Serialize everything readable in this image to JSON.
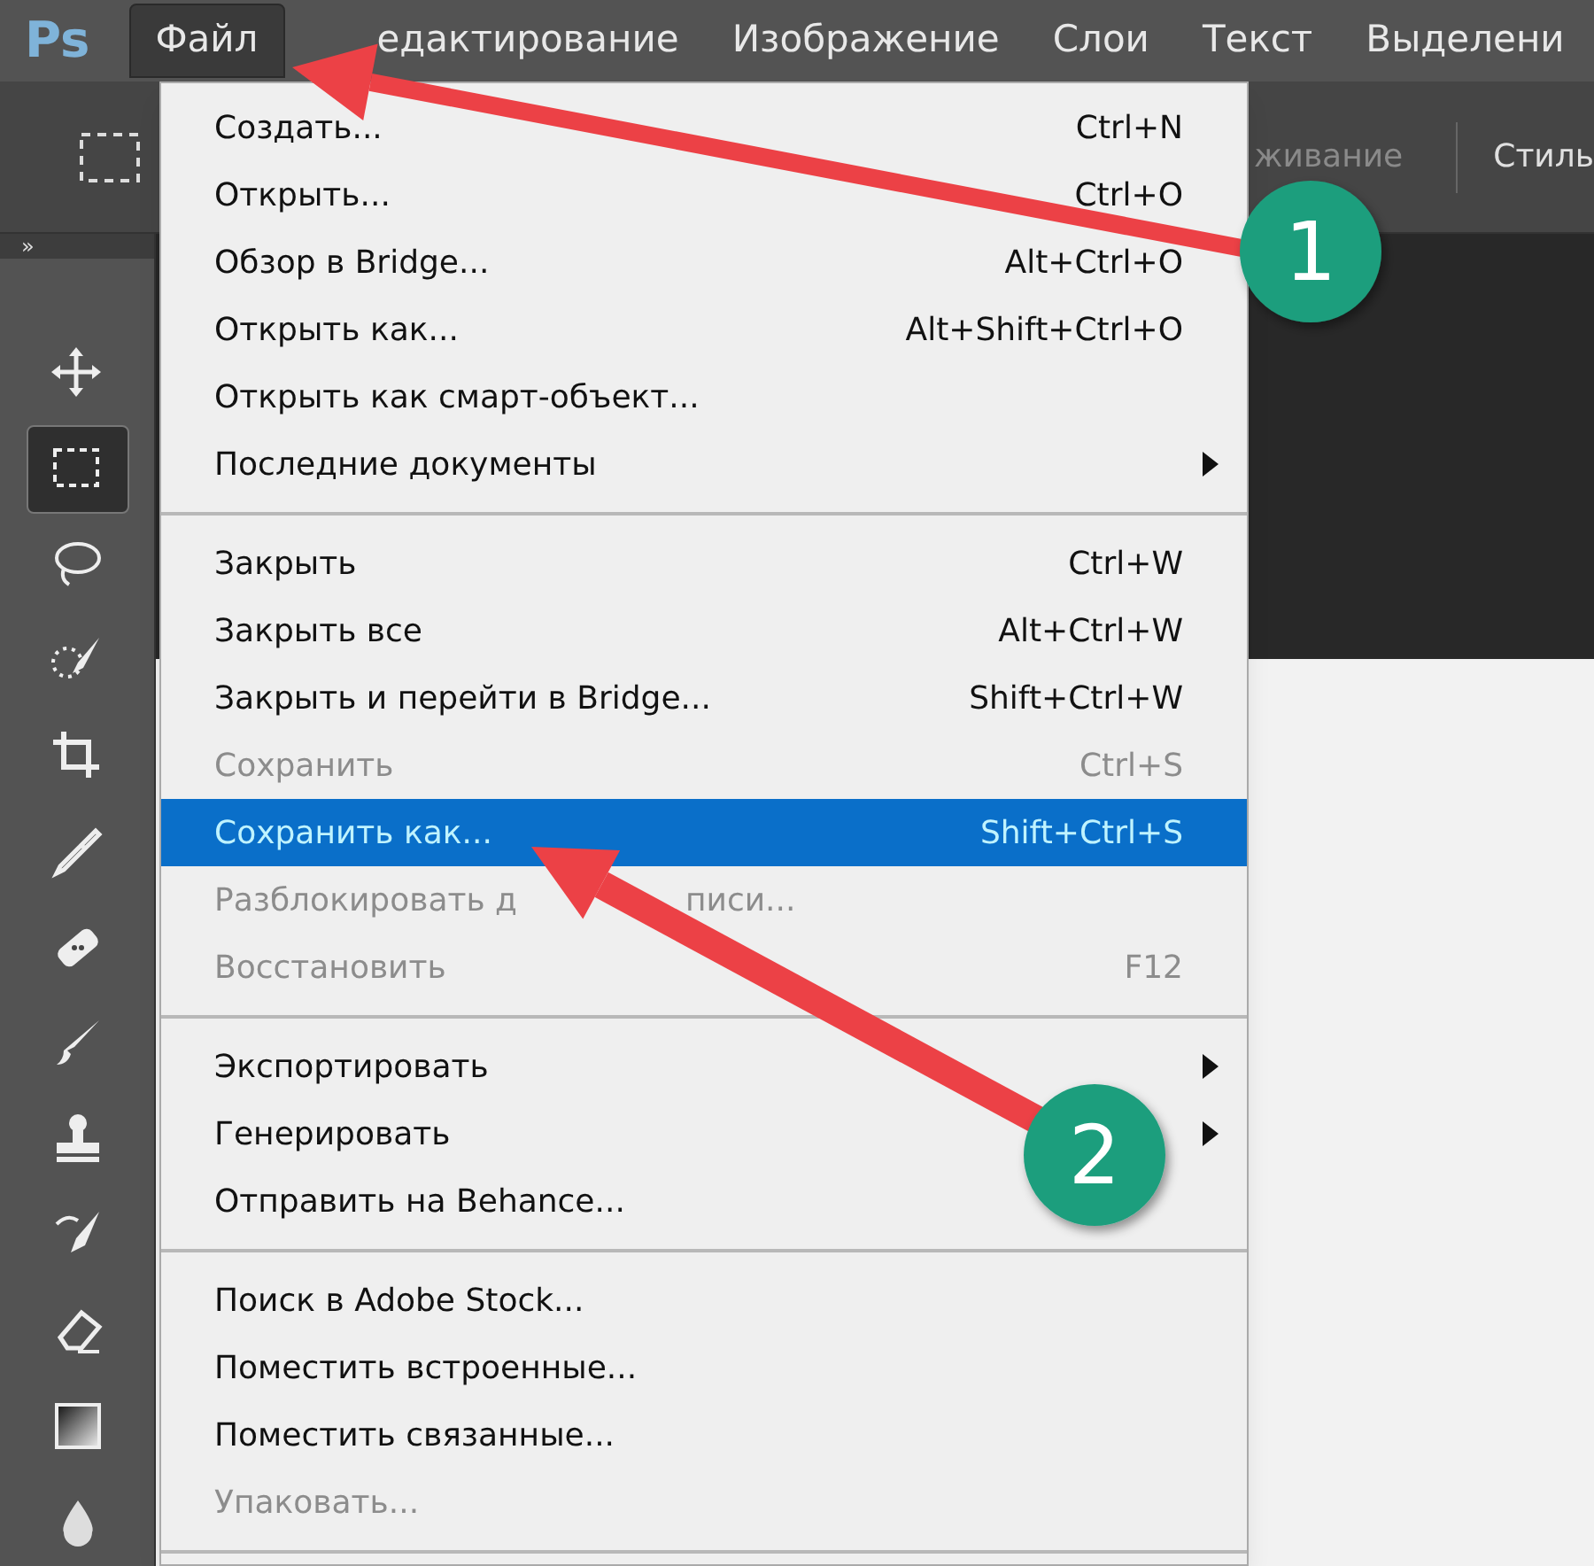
{
  "app_logo": "Ps",
  "menubar": [
    {
      "label": "Файл",
      "selected": true
    },
    {
      "label": "едактирование",
      "selected": false
    },
    {
      "label": "Изображение",
      "selected": false
    },
    {
      "label": "Слои",
      "selected": false
    },
    {
      "label": "Текст",
      "selected": false
    },
    {
      "label": "Выделени",
      "selected": false
    }
  ],
  "options_bar": {
    "dimmed_label": "живание",
    "style_label": "Стиль"
  },
  "panel_collapse": "»",
  "tools": [
    {
      "selected": false
    },
    {
      "selected": true
    },
    {
      "selected": false
    },
    {
      "selected": false
    },
    {
      "selected": false
    },
    {
      "selected": false
    },
    {
      "selected": false
    },
    {
      "selected": false
    },
    {
      "selected": false
    },
    {
      "selected": false
    },
    {
      "selected": false
    },
    {
      "selected": false
    },
    {
      "selected": false
    }
  ],
  "file_menu": [
    {
      "kind": "item",
      "label": "Создать...",
      "shortcut": "Ctrl+N",
      "disabled": false,
      "selected": false,
      "submenu": false
    },
    {
      "kind": "item",
      "label": "Открыть...",
      "shortcut": "Ctrl+O",
      "disabled": false,
      "selected": false,
      "submenu": false
    },
    {
      "kind": "item",
      "label": "Обзор в Bridge...",
      "shortcut": "Alt+Ctrl+O",
      "disabled": false,
      "selected": false,
      "submenu": false
    },
    {
      "kind": "item",
      "label": "Открыть как...",
      "shortcut": "Alt+Shift+Ctrl+O",
      "disabled": false,
      "selected": false,
      "submenu": false
    },
    {
      "kind": "item",
      "label": "Открыть как смарт-объект...",
      "disabled": false,
      "selected": false,
      "submenu": false
    },
    {
      "kind": "item",
      "label": "Последние документы",
      "disabled": false,
      "selected": false,
      "submenu": true
    },
    {
      "kind": "separator"
    },
    {
      "kind": "item",
      "label": "Закрыть",
      "shortcut": "Ctrl+W",
      "disabled": false,
      "selected": false,
      "submenu": false
    },
    {
      "kind": "item",
      "label": "Закрыть все",
      "shortcut": "Alt+Ctrl+W",
      "disabled": false,
      "selected": false,
      "submenu": false
    },
    {
      "kind": "item",
      "label": "Закрыть и перейти в Bridge...",
      "shortcut": "Shift+Ctrl+W",
      "disabled": false,
      "selected": false,
      "submenu": false
    },
    {
      "kind": "item",
      "label": "Сохранить",
      "shortcut": "Ctrl+S",
      "disabled": true,
      "selected": false,
      "submenu": false
    },
    {
      "kind": "item",
      "label": "Сохранить как...",
      "shortcut": "Shift+Ctrl+S",
      "disabled": false,
      "selected": true,
      "submenu": false
    },
    {
      "kind": "item",
      "label": "Разблокировать д",
      "label_tail": "писи...",
      "disabled": true,
      "selected": false,
      "submenu": false
    },
    {
      "kind": "item",
      "label": "Восстановить",
      "shortcut": "F12",
      "disabled": true,
      "selected": false,
      "submenu": false
    },
    {
      "kind": "separator"
    },
    {
      "kind": "item",
      "label": "Экспортировать",
      "disabled": false,
      "selected": false,
      "submenu": true
    },
    {
      "kind": "item",
      "label": "Генерировать",
      "disabled": false,
      "selected": false,
      "submenu": true
    },
    {
      "kind": "item",
      "label": "Отправить на Behance...",
      "disabled": false,
      "selected": false,
      "submenu": false
    },
    {
      "kind": "separator"
    },
    {
      "kind": "item",
      "label": "Поиск в Adobe Stock...",
      "disabled": false,
      "selected": false,
      "submenu": false
    },
    {
      "kind": "item",
      "label": "Поместить встроенные...",
      "disabled": false,
      "selected": false,
      "submenu": false
    },
    {
      "kind": "item",
      "label": "Поместить связанные...",
      "disabled": false,
      "selected": false,
      "submenu": false
    },
    {
      "kind": "item",
      "label": "Упаковать...",
      "disabled": true,
      "selected": false,
      "submenu": false
    },
    {
      "kind": "separator"
    }
  ],
  "annotations": [
    {
      "number": "1"
    },
    {
      "number": "2"
    }
  ]
}
